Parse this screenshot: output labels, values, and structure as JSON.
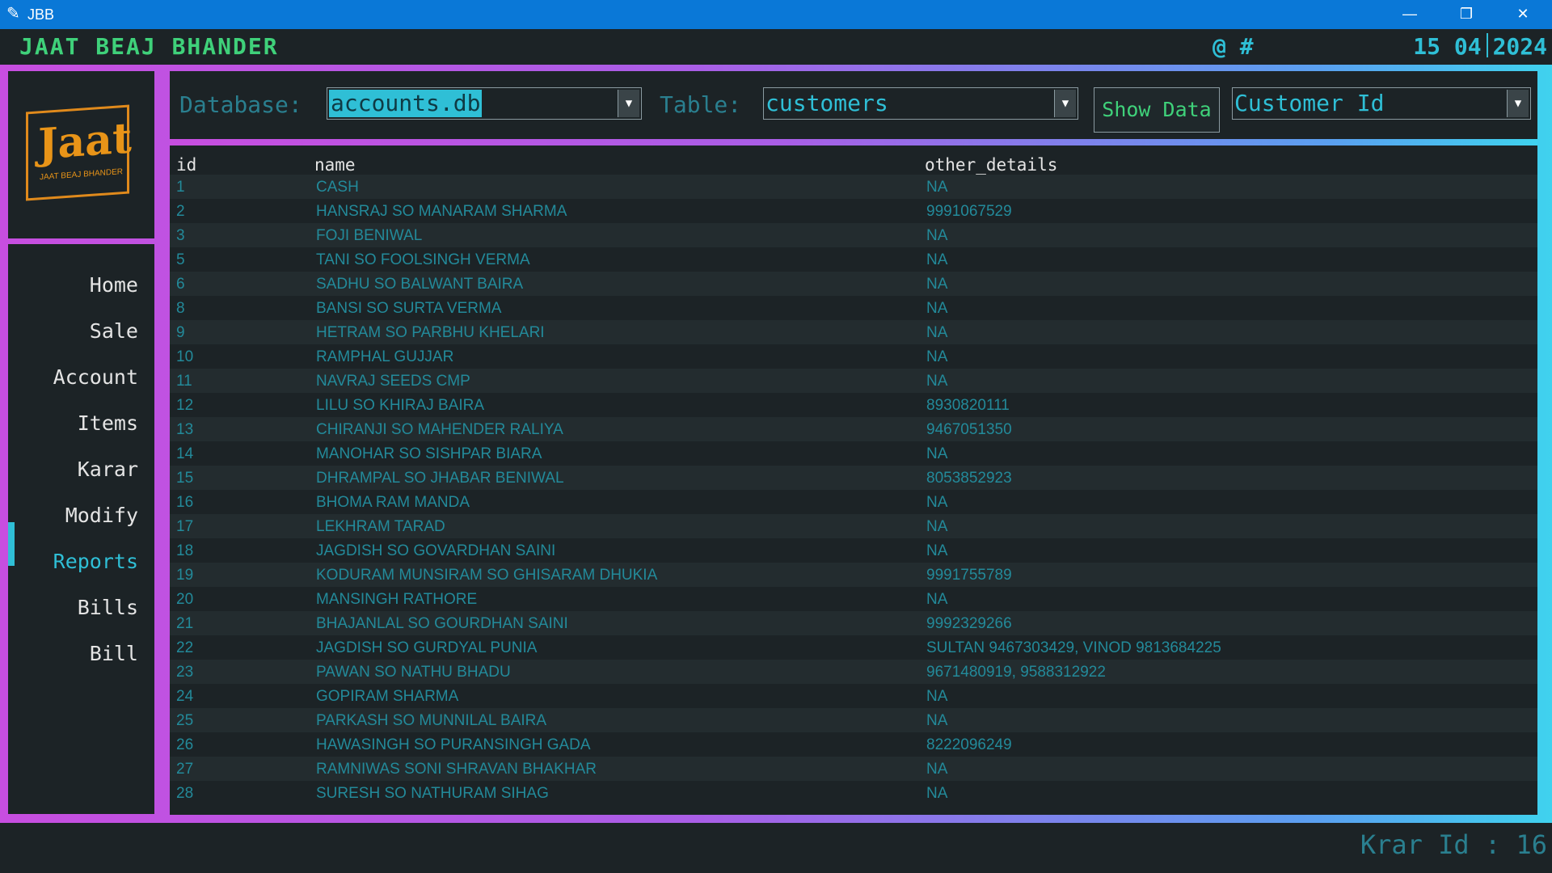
{
  "window": {
    "title": "JBB",
    "minimize": "—",
    "maximize": "❐",
    "close": "✕"
  },
  "header": {
    "app_title": "JAAT BEAJ BHANDER",
    "symbols": "@ #",
    "date_day_month": "15 04",
    "date_year": "2024"
  },
  "logo": {
    "text": "Jaat",
    "subtitle": "JAAT BEAJ BHANDER"
  },
  "sidebar": {
    "items": [
      {
        "label": "Home"
      },
      {
        "label": "Sale"
      },
      {
        "label": "Account"
      },
      {
        "label": "Items"
      },
      {
        "label": "Karar"
      },
      {
        "label": "Modify"
      },
      {
        "label": "Reports"
      },
      {
        "label": "Bills"
      },
      {
        "label": "Bill"
      }
    ],
    "active": "Reports"
  },
  "toolbar": {
    "database_label": "Database:",
    "database_value": "accounts.db",
    "table_label": "Table:",
    "table_value": "customers",
    "show_data_label": "Show Data",
    "sort_value": "Customer Id"
  },
  "table": {
    "columns": [
      "id",
      "name",
      "other_details"
    ],
    "rows": [
      [
        "1",
        "CASH",
        "NA"
      ],
      [
        "2",
        "HANSRAJ SO MANARAM SHARMA",
        "9991067529"
      ],
      [
        "3",
        "FOJI BENIWAL",
        "NA"
      ],
      [
        "5",
        "TANI SO FOOLSINGH VERMA",
        "NA"
      ],
      [
        "6",
        "SADHU SO BALWANT BAIRA",
        "NA"
      ],
      [
        "8",
        "BANSI SO SURTA VERMA",
        "NA"
      ],
      [
        "9",
        "HETRAM SO PARBHU KHELARI",
        "NA"
      ],
      [
        "10",
        "RAMPHAL GUJJAR",
        "NA"
      ],
      [
        "11",
        "NAVRAJ SEEDS CMP",
        "NA"
      ],
      [
        "12",
        "LILU SO KHIRAJ BAIRA",
        "8930820111"
      ],
      [
        "13",
        "CHIRANJI SO MAHENDER RALIYA",
        "9467051350"
      ],
      [
        "14",
        "MANOHAR SO SISHPAR BIARA",
        "NA"
      ],
      [
        "15",
        "DHRAMPAL SO JHABAR BENIWAL",
        "8053852923"
      ],
      [
        "16",
        "BHOMA RAM MANDA",
        "NA"
      ],
      [
        "17",
        "LEKHRAM TARAD",
        "NA"
      ],
      [
        "18",
        "JAGDISH SO GOVARDHAN SAINI",
        "NA"
      ],
      [
        "19",
        "KODURAM MUNSIRAM SO GHISARAM DHUKIA",
        "9991755789"
      ],
      [
        "20",
        "MANSINGH RATHORE",
        "NA"
      ],
      [
        "21",
        "BHAJANLAL SO GOURDHAN SAINI",
        "9992329266"
      ],
      [
        "22",
        "JAGDISH SO GURDYAL PUNIA",
        "SULTAN 9467303429, VINOD 9813684225"
      ],
      [
        "23",
        "PAWAN SO NATHU BHADU",
        "9671480919, 9588312922"
      ],
      [
        "24",
        "GOPIRAM SHARMA",
        "NA"
      ],
      [
        "25",
        "PARKASH SO MUNNILAL BAIRA",
        "NA"
      ],
      [
        "26",
        "HAWASINGH SO PURANSINGH GADA",
        "8222096249"
      ],
      [
        "27",
        "RAMNIWAS SONI SHRAVAN BHAKHAR",
        "NA"
      ],
      [
        "28",
        "SURESH SO NATHURAM SIHAG",
        "NA"
      ]
    ]
  },
  "status": {
    "krar_id": "Krar Id : 16"
  },
  "colors": {
    "accent": "#2fbfd6",
    "green": "#3fd17a",
    "background": "#1c2326",
    "logo": "#e89418"
  }
}
